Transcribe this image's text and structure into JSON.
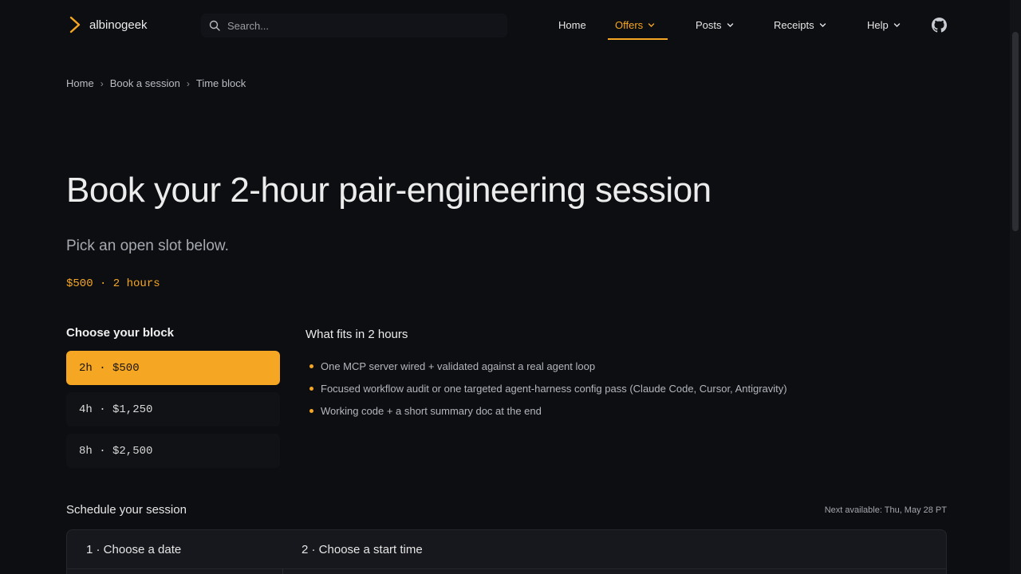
{
  "header": {
    "brand": "albinogeek",
    "search_placeholder": "Search...",
    "nav": [
      {
        "label": "Home"
      },
      {
        "label": "Offers"
      },
      {
        "label": "Posts"
      },
      {
        "label": "Receipts"
      },
      {
        "label": "Help"
      }
    ],
    "active_nav": "Offers",
    "accent": "#f5a623",
    "github_icon": "github-icon"
  },
  "breadcrumb": [
    "Home",
    "Book a session",
    "Time block"
  ],
  "page": {
    "title": "Book your 2-hour pair-engineering session",
    "subtitle": "Pick an open slot below.",
    "price": "$500 · 2 hours"
  },
  "blocks": {
    "heading": "Choose your block",
    "options": [
      {
        "label": "2h · $500",
        "selected": true
      },
      {
        "label": "4h · $1,250",
        "selected": false
      },
      {
        "label": "8h · $2,500",
        "selected": false
      }
    ]
  },
  "fits": {
    "heading": "What fits in 2 hours",
    "items": [
      "One MCP server wired + validated against a real agent loop",
      "Focused workflow audit or one targeted agent-harness config pass (Claude Code, Cursor, Antigravity)",
      "Working code + a short summary doc at the end"
    ]
  },
  "schedule": {
    "heading": "Schedule your session",
    "next_available": "Next available: Thu, May 28 PT",
    "step1": "1 · Choose a date",
    "step2": "2 · Choose a start time"
  }
}
